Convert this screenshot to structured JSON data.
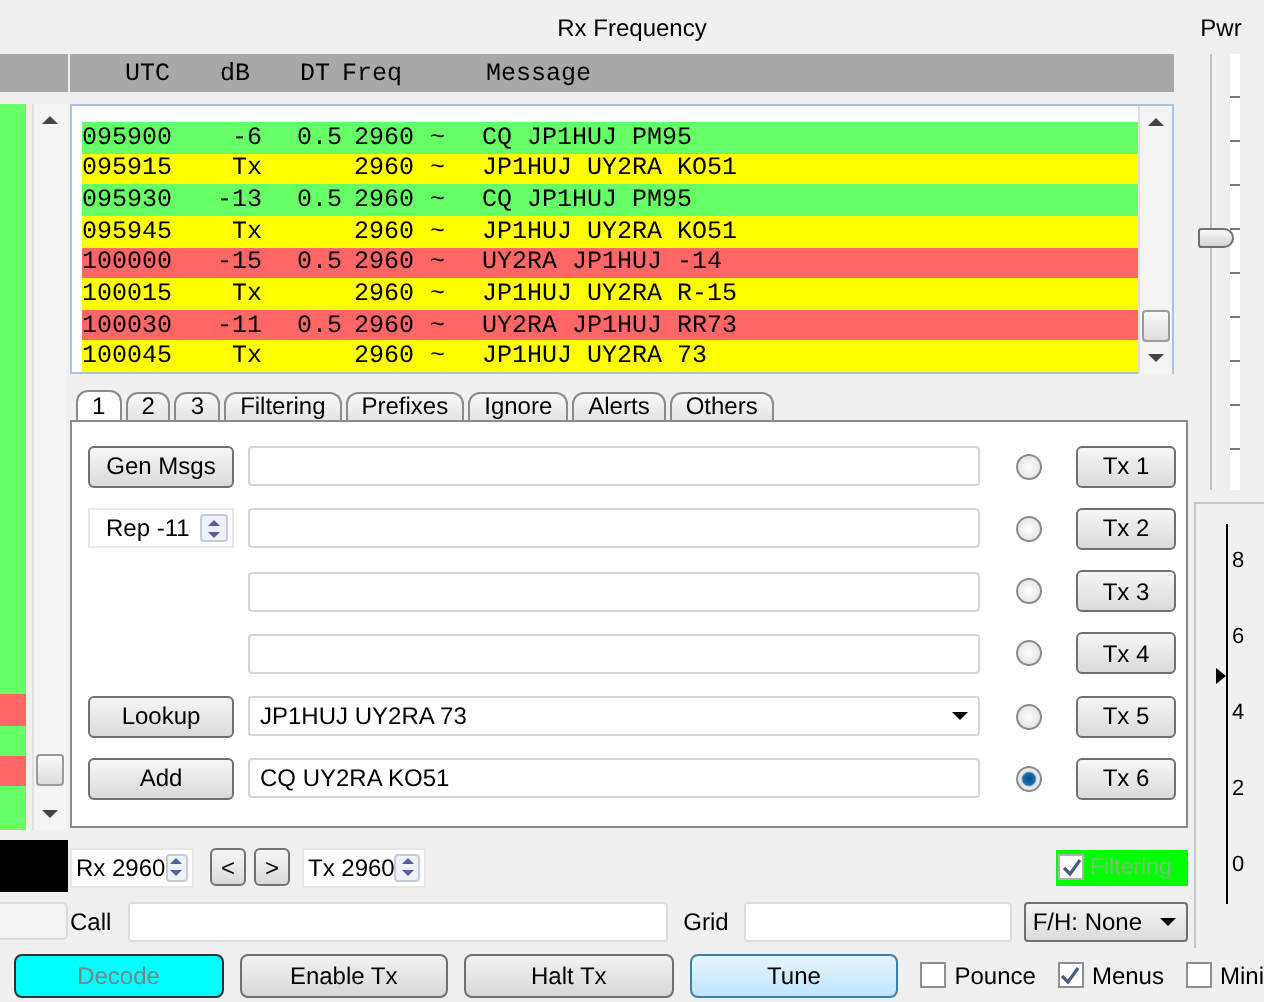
{
  "rx_frequency": {
    "title": "Rx Frequency",
    "columns": [
      "UTC",
      "dB",
      "DT",
      "Freq",
      "Message"
    ],
    "rows": [
      {
        "utc": "095900",
        "db": "-6",
        "dt": "0.5",
        "freq": "2960",
        "mode": "~",
        "message": "CQ JP1HUJ PM95",
        "color": "#66ff66"
      },
      {
        "utc": "095915",
        "db": "Tx",
        "freq": "2960",
        "mode": "~",
        "message": "JP1HUJ UY2RA KO51",
        "color": "#ffff00"
      },
      {
        "utc": "095930",
        "db": "-13",
        "dt": "0.5",
        "freq": "2960",
        "mode": "~",
        "message": "CQ JP1HUJ PM95",
        "color": "#66ff66"
      },
      {
        "utc": "095945",
        "db": "Tx",
        "freq": "2960",
        "mode": "~",
        "message": "JP1HUJ UY2RA KO51",
        "color": "#ffff00"
      },
      {
        "utc": "100000",
        "db": "-15",
        "dt": "0.5",
        "freq": "2960",
        "mode": "~",
        "message": "UY2RA JP1HUJ -14",
        "color": "#ff6666"
      },
      {
        "utc": "100015",
        "db": "Tx",
        "freq": "2960",
        "mode": "~",
        "message": "JP1HUJ UY2RA R-15",
        "color": "#ffff00"
      },
      {
        "utc": "100030",
        "db": "-11",
        "dt": "0.5",
        "freq": "2960",
        "mode": "~",
        "message": "UY2RA JP1HUJ RR73",
        "color": "#ff6666"
      },
      {
        "utc": "100045",
        "db": "Tx",
        "freq": "2960",
        "mode": "~",
        "message": "JP1HUJ UY2RA 73",
        "color": "#ffff00"
      }
    ]
  },
  "tabs": [
    {
      "label": "1",
      "selected": true
    },
    {
      "label": "2",
      "selected": false
    },
    {
      "label": "3",
      "selected": false
    },
    {
      "label": "Filtering",
      "selected": false
    },
    {
      "label": "Prefixes",
      "selected": false
    },
    {
      "label": "Ignore",
      "selected": false
    },
    {
      "label": "Alerts",
      "selected": false
    },
    {
      "label": "Others",
      "selected": false
    }
  ],
  "tx_rows": [
    {
      "left": {
        "kind": "button",
        "label": "Gen Msgs"
      },
      "kind": "text",
      "selected": false,
      "tx": "Tx 1"
    },
    {
      "left": {
        "kind": "spin",
        "label": "Rep -11"
      },
      "kind": "text",
      "selected": false,
      "tx": "Tx 2"
    },
    {
      "left": {
        "kind": "none"
      },
      "kind": "text",
      "selected": false,
      "tx": "Tx 3"
    },
    {
      "left": {
        "kind": "none"
      },
      "kind": "text",
      "selected": false,
      "tx": "Tx 4"
    },
    {
      "left": {
        "kind": "button",
        "label": "Lookup"
      },
      "kind": "combo",
      "message": "JP1HUJ UY2RA 73",
      "selected": false,
      "tx": "Tx 5"
    },
    {
      "left": {
        "kind": "button",
        "label": "Add"
      },
      "kind": "text",
      "message": "CQ UY2RA KO51",
      "selected": true,
      "tx": "Tx 6"
    }
  ],
  "freq_controls": {
    "rx": "Rx 2960",
    "down": "<",
    "up": ">",
    "tx": "Tx 2960",
    "filtering": {
      "label": "Filtering",
      "checked": true,
      "disabled": true
    }
  },
  "call_row": {
    "call_label": "Call",
    "grid_label": "Grid",
    "fh": "F/H: None"
  },
  "power": {
    "label": "Pwr",
    "level": 0.58
  },
  "meter": {
    "ticks": [
      "8",
      "6",
      "4",
      "2",
      "0"
    ],
    "level": 0.6
  },
  "buttons": [
    {
      "label": "Decode",
      "kind": "decode",
      "disabled": true
    },
    {
      "label": "Enable Tx",
      "kind": "plain",
      "disabled": false
    },
    {
      "label": "Halt Tx",
      "kind": "plain",
      "disabled": false
    },
    {
      "label": "Tune",
      "kind": "tune",
      "disabled": false
    }
  ],
  "options": [
    {
      "label": "Pounce",
      "checked": false
    },
    {
      "label": "Menus",
      "checked": true
    },
    {
      "label": "Mini",
      "checked": false
    }
  ]
}
